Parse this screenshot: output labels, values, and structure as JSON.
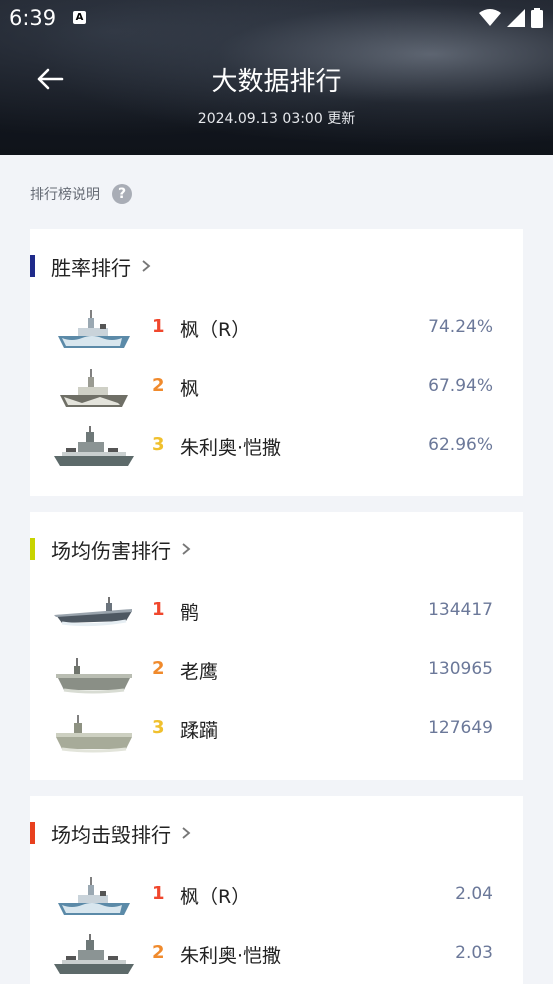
{
  "status_bar": {
    "time": "6:39",
    "notification_icon": "A"
  },
  "header": {
    "title": "大数据排行",
    "update_time": "2024.09.13 03:00 更新"
  },
  "explain": {
    "label": "排行榜说明",
    "help_glyph": "?"
  },
  "colors": {
    "rank1": "#f0472d",
    "rank2": "#f08a2c",
    "rank3": "#f0c02d",
    "accent_winrate": "#1f2a8a",
    "accent_damage": "#c8d400",
    "accent_kills": "#e8401e"
  },
  "sections": [
    {
      "title": "胜率排行",
      "rows": [
        {
          "rank": "1",
          "name": "枫（R）",
          "value": "74.24%",
          "ship_icon": "destroyer-camo-ship-icon"
        },
        {
          "rank": "2",
          "name": "枫",
          "value": "67.94%",
          "ship_icon": "destroyer-camo-ship-icon"
        },
        {
          "rank": "3",
          "name": "朱利奥·恺撒",
          "value": "62.96%",
          "ship_icon": "battleship-ship-icon"
        }
      ]
    },
    {
      "title": "场均伤害排行",
      "rows": [
        {
          "rank": "1",
          "name": "鹘",
          "value": "134417",
          "ship_icon": "carrier-ship-icon"
        },
        {
          "rank": "2",
          "name": "老鹰",
          "value": "130965",
          "ship_icon": "carrier-ship-icon"
        },
        {
          "rank": "3",
          "name": "蹂躏",
          "value": "127649",
          "ship_icon": "carrier-ship-icon"
        }
      ]
    },
    {
      "title": "场均击毁排行",
      "rows": [
        {
          "rank": "1",
          "name": "枫（R）",
          "value": "2.04",
          "ship_icon": "destroyer-camo-ship-icon"
        },
        {
          "rank": "2",
          "name": "朱利奥·恺撒",
          "value": "2.03",
          "ship_icon": "battleship-ship-icon"
        }
      ]
    }
  ]
}
